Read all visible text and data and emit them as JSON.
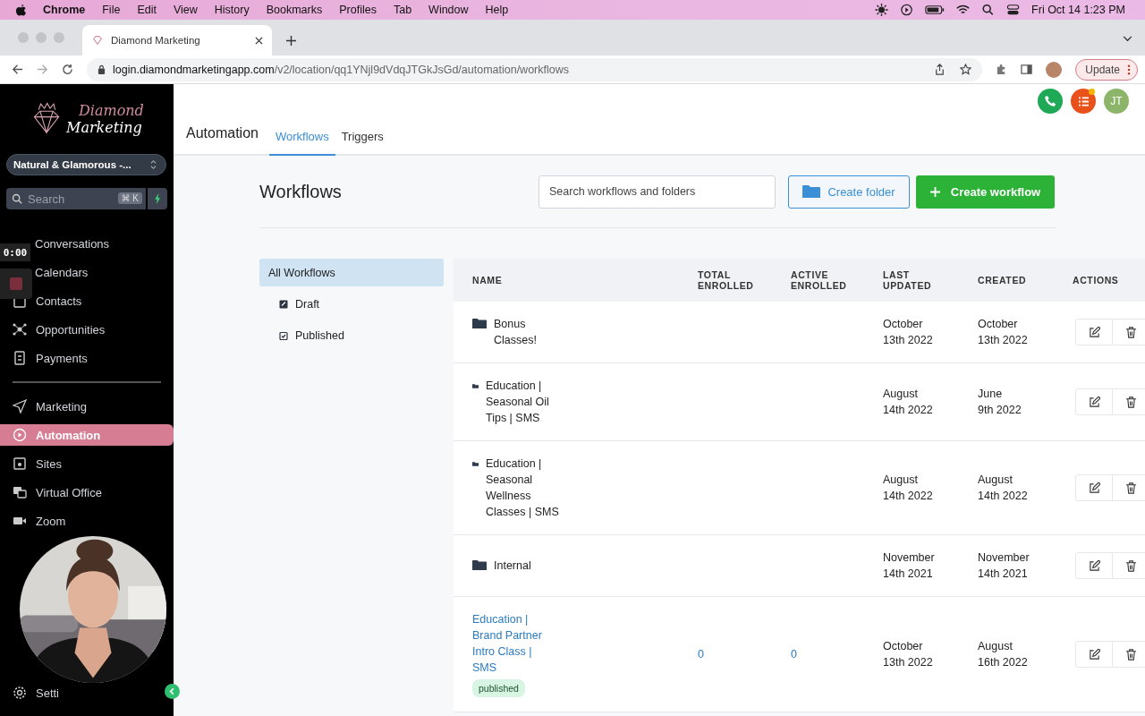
{
  "menubar": {
    "app": "Chrome",
    "menus": [
      "File",
      "Edit",
      "View",
      "History",
      "Bookmarks",
      "Profiles",
      "Tab",
      "Window",
      "Help"
    ],
    "clock": "Fri Oct 14  1:23 PM"
  },
  "browser": {
    "tab_title": "Diamond Marketing",
    "url_host": "login.diamondmarketingapp.com",
    "url_path": "/v2/location/qq1YNjl9dVdqJTGkJsGd/automation/workflows",
    "update_label": "Update"
  },
  "sidebar": {
    "logo_line1": "Diamond",
    "logo_line2": "Marketing",
    "account": "Natural & Glamorous -...",
    "search_placeholder": "Search",
    "search_shortcut": "⌘ K",
    "items": [
      {
        "label": "Conversations",
        "selected": false
      },
      {
        "label": "Calendars",
        "selected": false
      },
      {
        "label": "Contacts",
        "selected": false
      },
      {
        "label": "Opportunities",
        "selected": false
      },
      {
        "label": "Payments",
        "selected": false
      }
    ],
    "items2": [
      {
        "label": "Marketing",
        "selected": false
      },
      {
        "label": "Automation",
        "selected": true
      },
      {
        "label": "Sites",
        "selected": false
      },
      {
        "label": "Virtual Office",
        "selected": false
      },
      {
        "label": "Zoom",
        "selected": false
      }
    ],
    "settings_label": "Setti"
  },
  "recorder": {
    "timer": "0:00"
  },
  "header": {
    "title": "Automation",
    "tabs": [
      {
        "label": "Workflows",
        "selected": true
      },
      {
        "label": "Triggers",
        "selected": false
      }
    ],
    "avatar": "JT"
  },
  "page": {
    "title": "Workflows",
    "search_placeholder": "Search workflows and folders",
    "create_folder": "Create folder",
    "create_workflow": "Create workflow"
  },
  "filters": [
    {
      "label": "All Workflows",
      "kind": "all",
      "selected": true
    },
    {
      "label": "Draft",
      "kind": "draft",
      "selected": false
    },
    {
      "label": "Published",
      "kind": "published",
      "selected": false
    }
  ],
  "table": {
    "columns": [
      "NAME",
      "TOTAL ENROLLED",
      "ACTIVE ENROLLED",
      "LAST UPDATED",
      "CREATED",
      "ACTIONS"
    ],
    "rows": [
      {
        "kind": "folder",
        "name": "Bonus Classes!",
        "last_updated": "October 13th 2022",
        "created": "October 13th 2022"
      },
      {
        "kind": "subfolder",
        "name": "Education | Seasonal Oil Tips | SMS",
        "last_updated": "August 14th 2022",
        "created": "June 9th 2022"
      },
      {
        "kind": "subfolder",
        "name": "Education | Seasonal Wellness Classes | SMS",
        "last_updated": "August 14th 2022",
        "created": "August 14th 2022"
      },
      {
        "kind": "folder",
        "name": "Internal",
        "last_updated": "November 14th 2021",
        "created": "November 14th 2021"
      },
      {
        "kind": "workflow",
        "name": "Education | Brand Partner Intro Class | SMS",
        "status": "published",
        "total_enrolled": "0",
        "active_enrolled": "0",
        "last_updated": "October 13th 2022",
        "created": "August 16th 2022"
      }
    ]
  }
}
